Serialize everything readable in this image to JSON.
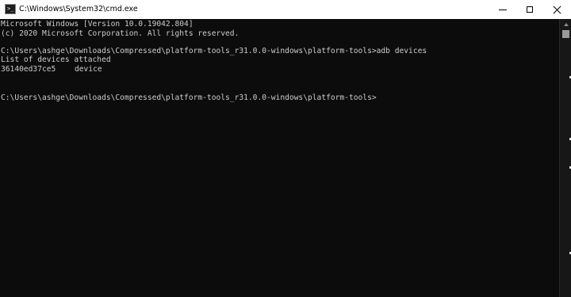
{
  "window": {
    "title": "C:\\Windows\\System32\\cmd.exe",
    "icon": "cmd-icon",
    "controls": {
      "minimize": "minimize-icon",
      "maximize": "maximize-icon",
      "close": "close-icon"
    }
  },
  "console": {
    "lines": [
      "Microsoft Windows [Version 10.0.19042.804]",
      "(c) 2020 Microsoft Corporation. All rights reserved.",
      "C:\\Users\\ashge\\Downloads\\Compressed\\platform-tools_r31.0.0-windows\\platform-tools>adb devices",
      "List of devices attached",
      "C:\\Users\\ashge\\Downloads\\Compressed\\platform-tools_r31.0.0-windows\\platform-tools>"
    ],
    "device": {
      "serial": "36140ed37ce5",
      "status": "device"
    }
  },
  "colors": {
    "background": "#0c0c0c",
    "text": "#cccccc",
    "titlebar": "#ffffff"
  }
}
